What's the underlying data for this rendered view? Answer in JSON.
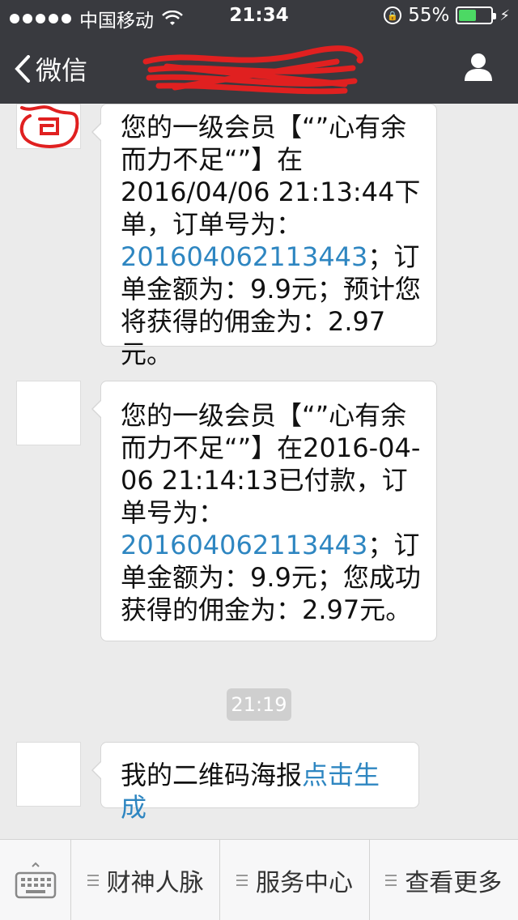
{
  "status_bar": {
    "carrier": "中国移动",
    "time": "21:34",
    "battery_percent_text": "55%",
    "battery_level": 0.55
  },
  "nav": {
    "back_label": "微信",
    "title_redacted": "",
    "icons": {
      "back": "chevron-left-icon",
      "profile": "person-icon"
    }
  },
  "messages": [
    {
      "pre": "您的一级会员【“”心有余而力不足“”】在2016/04/06 21:13:44下单，订单号为：",
      "link": "201604062113443",
      "post": "；订单金额为：9.9元；预计您将获得的佣金为：2.97元。"
    },
    {
      "pre": "您的一级会员【“”心有余而力不足“”】在2016-04-06 21:14:13已付款，订单号为：",
      "link": "201604062113443",
      "post": "；订单金额为：9.9元；您成功获得的佣金为：2.97元。"
    },
    {
      "timestamp": "21:19"
    },
    {
      "pre": "我的二维码海报",
      "link": "点击生成",
      "post": ""
    }
  ],
  "bottom_menu": {
    "keyboard_icon": "keyboard-icon",
    "items": [
      {
        "label": "财神人脉",
        "icon": "menu-lines-icon"
      },
      {
        "label": "服务中心",
        "icon": "menu-lines-icon"
      },
      {
        "label": "查看更多",
        "icon": "menu-lines-icon"
      }
    ]
  },
  "colors": {
    "nav_bg": "#393a3f",
    "chat_bg": "#ebebeb",
    "link": "#2e86c1",
    "battery_fill": "#4cd964",
    "redaction": "#e02020"
  }
}
